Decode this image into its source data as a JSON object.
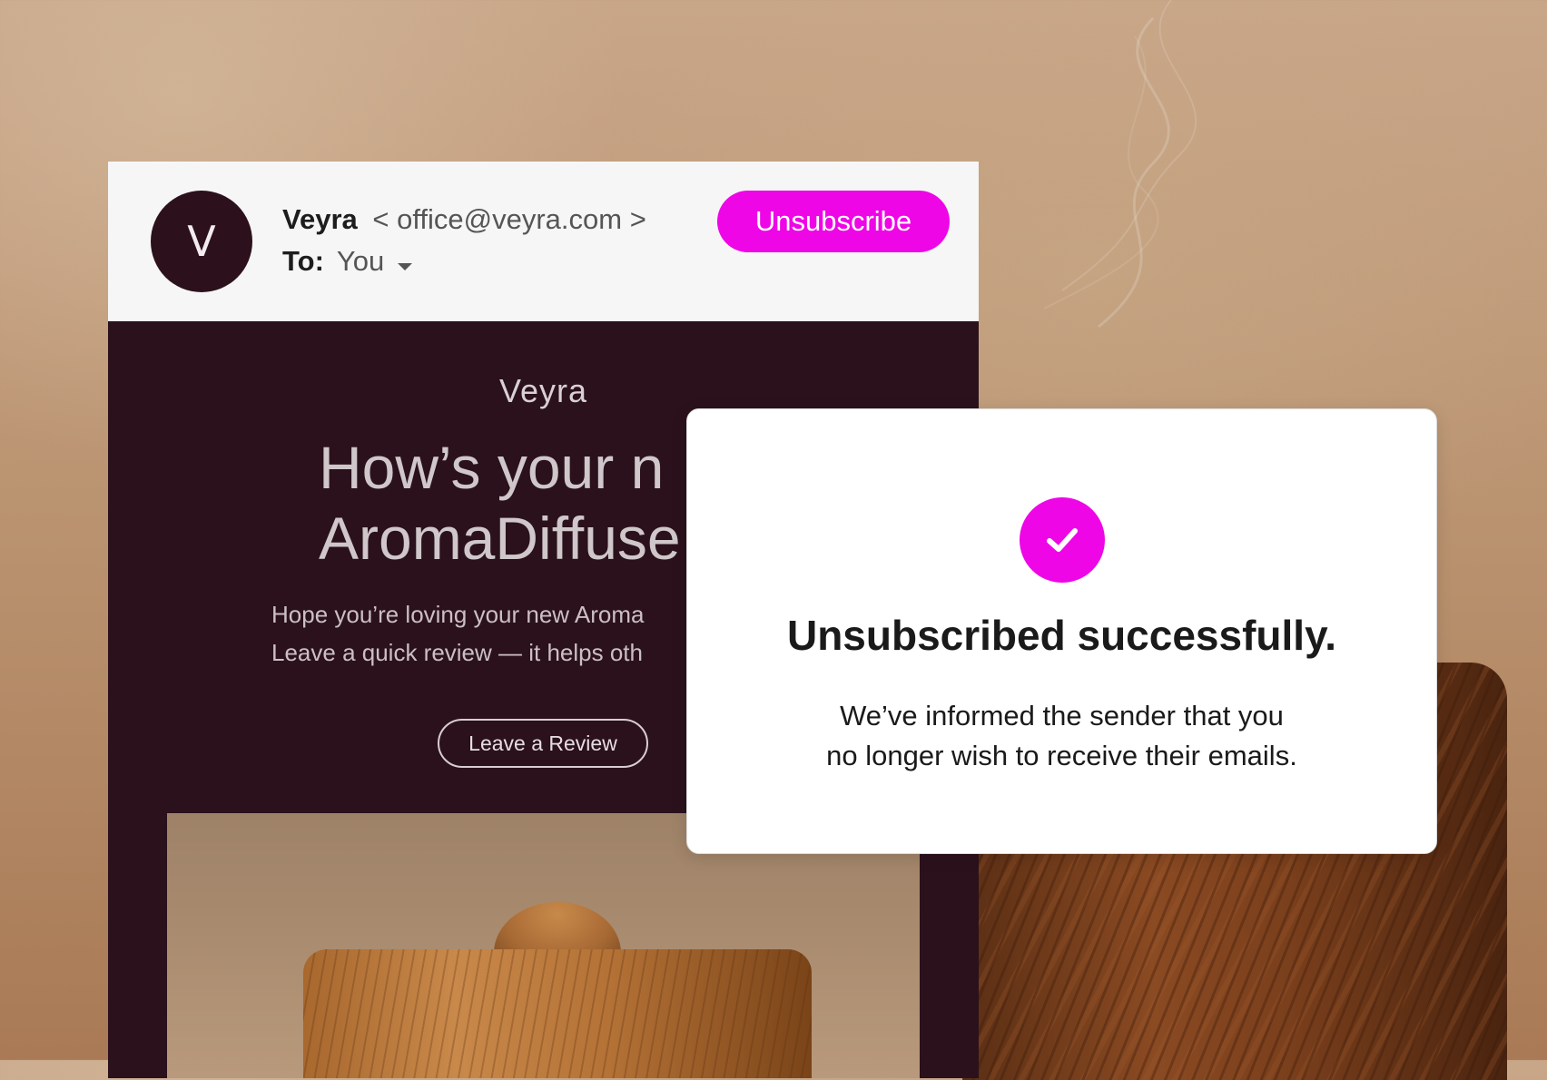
{
  "colors": {
    "accent": "#ee06e6",
    "email_body_bg": "#2b111c",
    "header_bg": "#f6f6f6",
    "avatar_bg": "#2c111c"
  },
  "email_header": {
    "avatar_letter": "V",
    "sender_name": "Veyra",
    "sender_address": "< office@veyra.com >",
    "to_label": "To:",
    "to_value": "You",
    "unsubscribe_label": "Unsubscribe"
  },
  "email_body": {
    "brand": "Veyra",
    "headline_line1": "How’s your n",
    "headline_line2": "AromaDiffuse",
    "intro_line1": "Hope you’re loving your new Aroma",
    "intro_line2": "Leave a quick review — it helps oth",
    "review_button_label": "Leave a Review"
  },
  "dialog": {
    "icon": "check-icon",
    "title": "Unsubscribed successfully.",
    "message_line1": "We’ve informed the sender that you",
    "message_line2": "no longer wish to receive their emails."
  }
}
